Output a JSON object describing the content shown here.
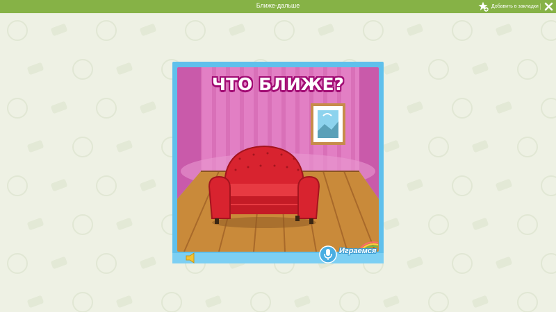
{
  "topbar": {
    "title": "Ближе-дальше",
    "bookmark_label": "Добавить в закладки",
    "bookmark_icon": "star-plus-icon",
    "close_icon": "close-icon"
  },
  "game": {
    "heading": "ЧТО БЛИЖЕ?",
    "sound_icon": "speaker-icon",
    "mic_icon": "microphone-icon",
    "logo_text": "Играемся"
  },
  "colors": {
    "topbar": "#86b246",
    "background": "#eef1e4",
    "frame": "#5fc0ec",
    "wall": "#e27fc4",
    "sofa": "#d8232f",
    "floor": "#c98a3a"
  }
}
